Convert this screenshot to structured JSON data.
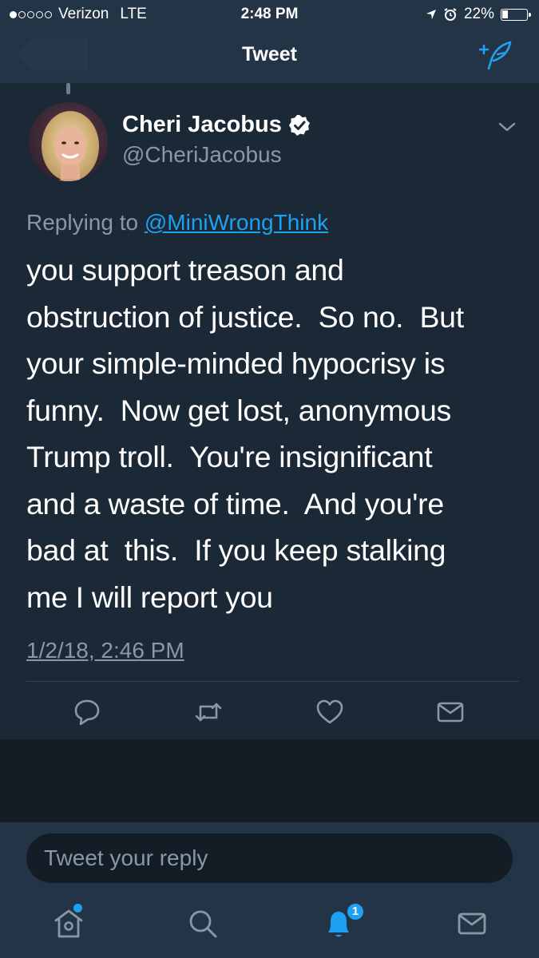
{
  "status_bar": {
    "carrier": "Verizon",
    "network": "LTE",
    "time": "2:48 PM",
    "battery": "22%",
    "signal_bars_filled": 1,
    "signal_bars_total": 5
  },
  "nav": {
    "title": "Tweet",
    "back_icon": "back-chevron-icon",
    "compose_icon": "compose-tweet-icon"
  },
  "tweet": {
    "author_name": "Cheri Jacobus",
    "verified": true,
    "handle": "@CheriJacobus",
    "replying_prefix": "Replying to",
    "replying_to": "@MiniWrongThink",
    "text": "you support treason and\nobstruction of justice.  So no.  But\nyour simple-minded hypocrisy is\nfunny.  Now get lost, anonymous\nTrump troll.  You're insignificant\nand a waste of time.  And you're\nbad at  this.  If you keep stalking\nme I will report you",
    "timestamp": "1/2/18, 2:46 PM"
  },
  "actions": [
    "reply-icon",
    "retweet-icon",
    "like-icon",
    "direct-message-icon"
  ],
  "reply_bar": {
    "placeholder": "Tweet your reply"
  },
  "tab_bar": {
    "tabs": [
      "home-icon",
      "search-icon",
      "notifications-icon",
      "messages-icon"
    ],
    "notifications_badge": "1"
  },
  "colors": {
    "background": "#1b2836",
    "bar": "#243447",
    "accent": "#1da1f2",
    "secondary_text": "#8899a6"
  }
}
